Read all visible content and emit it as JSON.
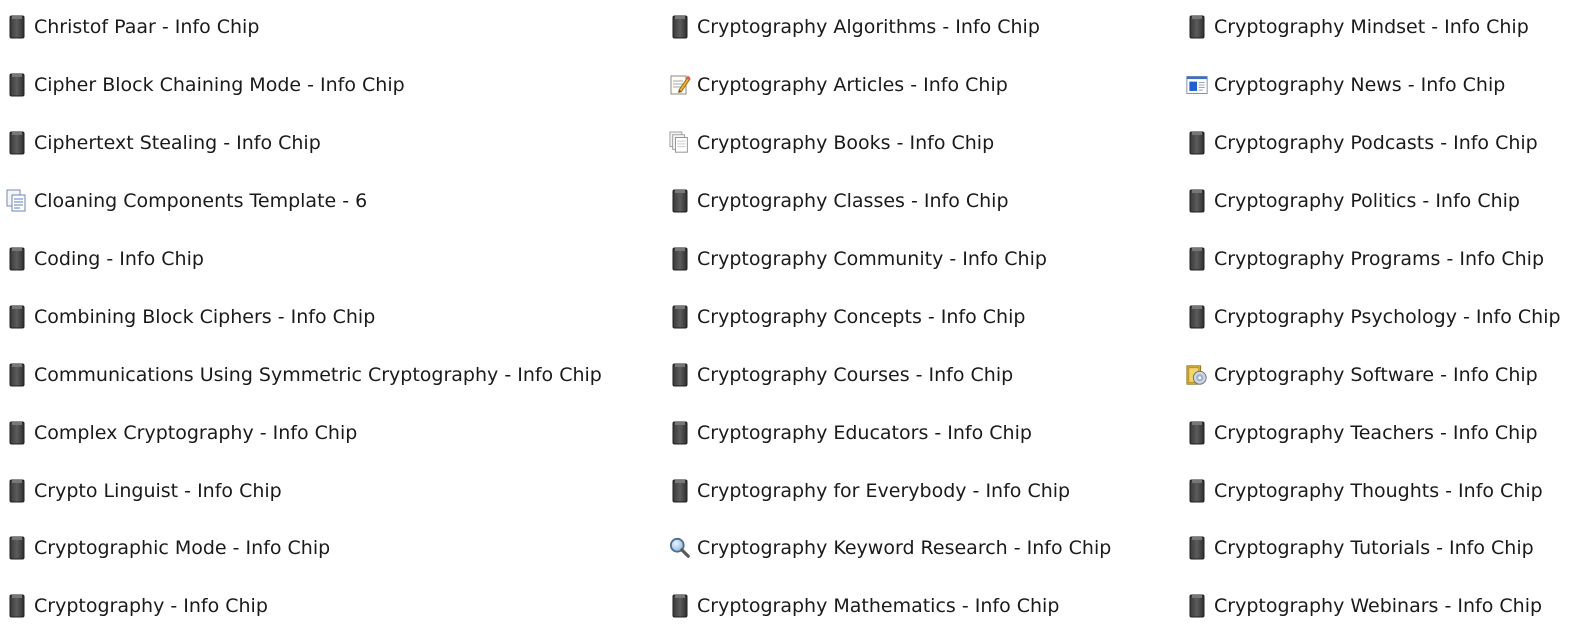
{
  "columns": [
    {
      "items": [
        {
          "label": "Christof Paar - Info Chip",
          "icon": "info-chip-file-icon"
        },
        {
          "label": "Cipher Block Chaining Mode - Info Chip",
          "icon": "info-chip-file-icon"
        },
        {
          "label": "Ciphertext Stealing - Info Chip",
          "icon": "info-chip-file-icon"
        },
        {
          "label": "Cloaning Components Template - 6",
          "icon": "document-pages-icon"
        },
        {
          "label": "Coding - Info Chip",
          "icon": "info-chip-file-icon"
        },
        {
          "label": "Combining Block Ciphers - Info Chip",
          "icon": "info-chip-file-icon"
        },
        {
          "label": "Communications Using Symmetric Cryptography - Info Chip",
          "icon": "info-chip-file-icon"
        },
        {
          "label": "Complex Cryptography - Info Chip",
          "icon": "info-chip-file-icon"
        },
        {
          "label": "Crypto Linguist - Info Chip",
          "icon": "info-chip-file-icon"
        },
        {
          "label": "Cryptographic Mode - Info Chip",
          "icon": "info-chip-file-icon"
        },
        {
          "label": "Cryptography - Info Chip",
          "icon": "info-chip-file-icon"
        }
      ]
    },
    {
      "items": [
        {
          "label": "Cryptography Algorithms  - Info Chip",
          "icon": "info-chip-file-icon"
        },
        {
          "label": "Cryptography Articles - Info Chip",
          "icon": "notepad-pencil-icon"
        },
        {
          "label": "Cryptography Books - Info Chip",
          "icon": "stacked-pages-icon"
        },
        {
          "label": "Cryptography Classes - Info Chip",
          "icon": "info-chip-file-icon"
        },
        {
          "label": "Cryptography Community - Info Chip",
          "icon": "info-chip-file-icon"
        },
        {
          "label": "Cryptography Concepts - Info Chip",
          "icon": "info-chip-file-icon"
        },
        {
          "label": "Cryptography Courses - Info Chip",
          "icon": "info-chip-file-icon"
        },
        {
          "label": "Cryptography Educators - Info Chip",
          "icon": "info-chip-file-icon"
        },
        {
          "label": "Cryptography for Everybody - Info Chip",
          "icon": "info-chip-file-icon"
        },
        {
          "label": "Cryptography Keyword Research - Info Chip",
          "icon": "magnifier-icon"
        },
        {
          "label": "Cryptography Mathematics - Info Chip",
          "icon": "info-chip-file-icon"
        }
      ]
    },
    {
      "items": [
        {
          "label": "Cryptography Mindset - Info Chip",
          "icon": "info-chip-file-icon"
        },
        {
          "label": "Cryptography News - Info Chip",
          "icon": "news-window-icon"
        },
        {
          "label": "Cryptography Podcasts - Info Chip",
          "icon": "info-chip-file-icon"
        },
        {
          "label": "Cryptography Politics - Info Chip",
          "icon": "info-chip-file-icon"
        },
        {
          "label": "Cryptography Programs - Info Chip",
          "icon": "info-chip-file-icon"
        },
        {
          "label": "Cryptography Psychology - Info Chip",
          "icon": "info-chip-file-icon"
        },
        {
          "label": "Cryptography Software - Info Chip",
          "icon": "software-disc-icon"
        },
        {
          "label": "Cryptography Teachers - Info Chip",
          "icon": "info-chip-file-icon"
        },
        {
          "label": "Cryptography Thoughts - Info Chip",
          "icon": "info-chip-file-icon"
        },
        {
          "label": "Cryptography Tutorials - Info Chip",
          "icon": "info-chip-file-icon"
        },
        {
          "label": "Cryptography Webinars - Info Chip",
          "icon": "info-chip-file-icon"
        }
      ]
    }
  ]
}
